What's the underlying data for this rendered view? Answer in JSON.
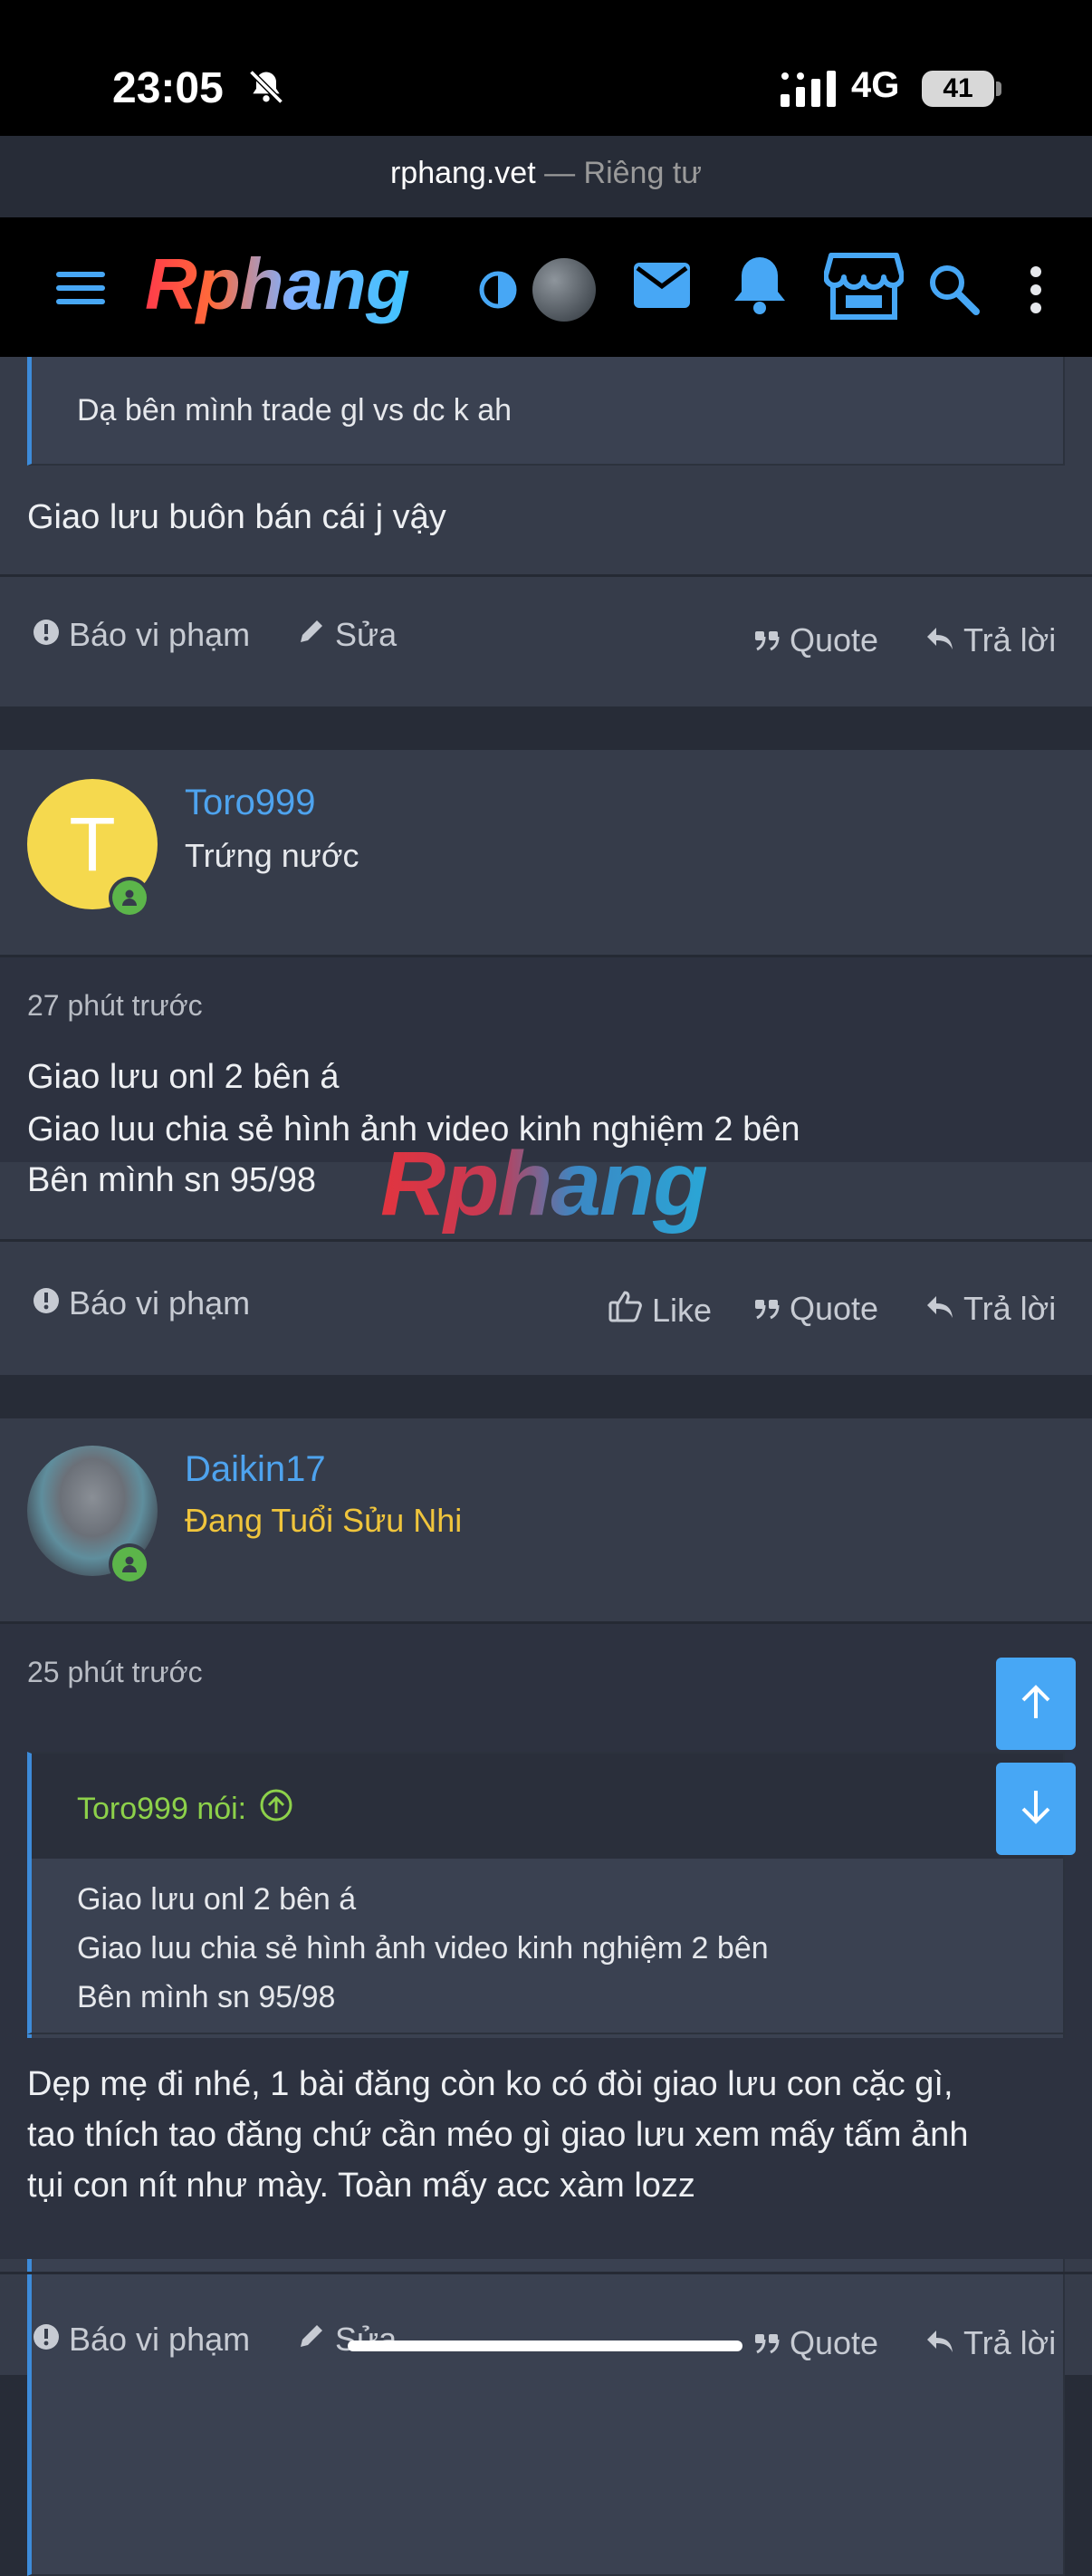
{
  "status_bar": {
    "time": "23:05",
    "network": "4G",
    "battery": "41"
  },
  "browser": {
    "domain": "rphang.vet",
    "privacy": "— Riêng tư"
  },
  "navbar": {
    "logo": "Rphang",
    "icons": [
      "menu-icon",
      "theme-toggle-icon",
      "avatar",
      "mail-icon",
      "bell-icon",
      "store-icon",
      "search-icon",
      "more-icon"
    ],
    "accent": "#47a7f5"
  },
  "post1": {
    "quote": "Dạ bên mình trade gl vs dc k ah",
    "body": "Giao lưu buôn bán cái j vậy",
    "actions": {
      "report": "Báo vi phạm",
      "edit": "Sửa",
      "quote": "Quote",
      "reply": "Trả lời"
    }
  },
  "post2": {
    "author": "Toro999",
    "avatar_letter": "T",
    "avatar_color": "#f5d94e",
    "rank": "Trứng nước",
    "time": "27 phút trước",
    "lines": [
      "Giao lưu onl 2 bên á",
      "Giao luu chia sẻ hình ảnh video kinh nghiệm 2 bên",
      "Bên mình sn 95/98"
    ],
    "actions": {
      "report": "Báo vi phạm",
      "like": "Like",
      "quote": "Quote",
      "reply": "Trả lời"
    }
  },
  "post3": {
    "author": "Daikin17",
    "rank": "Đang Tuổi Sửu Nhi",
    "rank_color": "#f0c53c",
    "time": "25 phút trước",
    "quote_header": "Toro999 nói:",
    "quote_lines": [
      "Giao lưu onl 2 bên á",
      "Giao luu chia sẻ hình ảnh video kinh nghiệm 2 bên",
      "Bên mình sn 95/98"
    ],
    "body_lines": [
      "Dẹp mẹ đi nhé, 1 bài đăng còn ko có đòi giao lưu con cặc gì,",
      "tao thích tao đăng chứ cần méo gì giao lưu xem mấy tấm ảnh",
      "tụi con nít như mày. Toàn mấy acc xàm lozz"
    ],
    "actions": {
      "report": "Báo vi phạm",
      "edit": "Sửa",
      "quote": "Quote",
      "reply": "Trả lời"
    }
  },
  "watermark": "Rphang"
}
